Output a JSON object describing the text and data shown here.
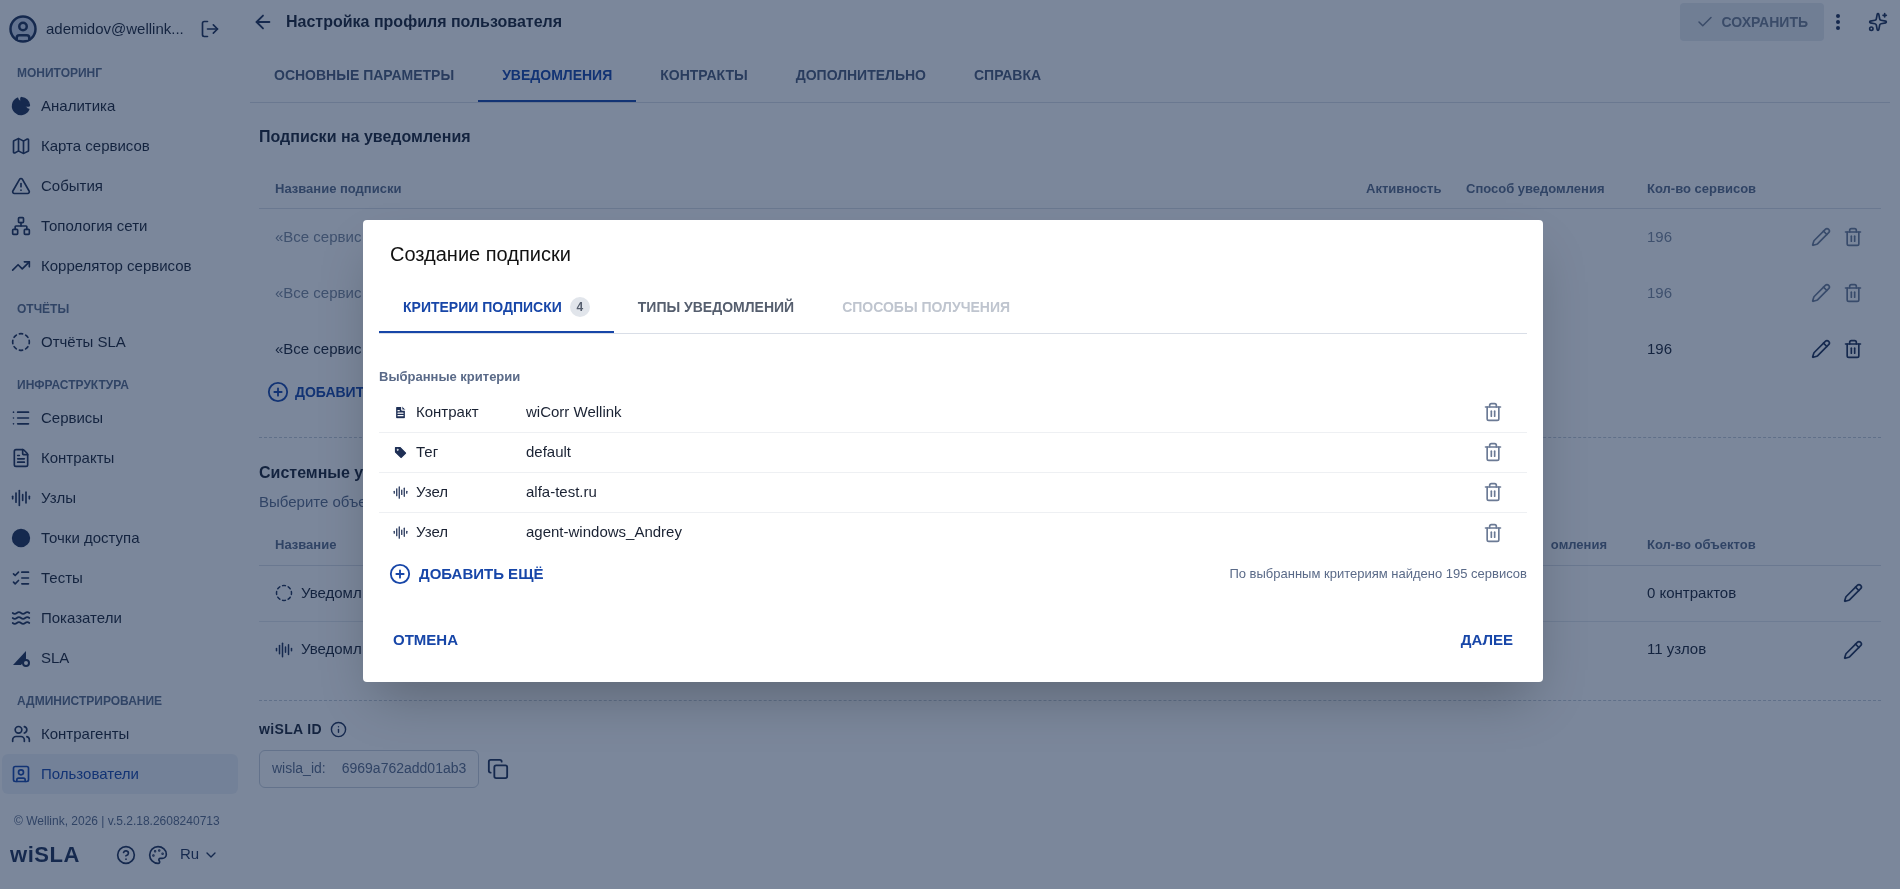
{
  "sidebar": {
    "user": "ademidov@wellink...",
    "sections": [
      {
        "title": "МОНИТОРИНГ",
        "items": [
          {
            "label": "Аналитика",
            "selected": false
          },
          {
            "label": "Карта сервисов",
            "selected": false
          },
          {
            "label": "События",
            "selected": false
          },
          {
            "label": "Топология сети",
            "selected": false
          },
          {
            "label": "Коррелятор сервисов",
            "selected": false
          }
        ]
      },
      {
        "title": "ОТЧЁТЫ",
        "items": [
          {
            "label": "Отчёты SLA",
            "selected": false
          }
        ]
      },
      {
        "title": "ИНФРАСТРУКТУРА",
        "items": [
          {
            "label": "Сервисы",
            "selected": false
          },
          {
            "label": "Контракты",
            "selected": false
          },
          {
            "label": "Узлы",
            "selected": false
          },
          {
            "label": "Точки доступа",
            "selected": false
          },
          {
            "label": "Тесты",
            "selected": false
          },
          {
            "label": "Показатели",
            "selected": false
          },
          {
            "label": "SLA",
            "selected": false
          }
        ]
      },
      {
        "title": "АДМИНИСТРИРОВАНИЕ",
        "items": [
          {
            "label": "Контрагенты",
            "selected": false
          },
          {
            "label": "Пользователи",
            "selected": true
          }
        ]
      }
    ],
    "footer": "© Wellink, 2026 | v.5.2.18.2608240713",
    "logo": "wiSLA",
    "language": "Ru"
  },
  "header": {
    "title": "Настройка профиля пользователя",
    "save": {
      "label": "СОХРАНИТЬ",
      "disabled": true
    }
  },
  "tabs": [
    {
      "label": "ОСНОВНЫЕ ПАРАМЕТРЫ",
      "selected": false
    },
    {
      "label": "УВЕДОМЛЕНИЯ",
      "selected": true
    },
    {
      "label": "КОНТРАКТЫ",
      "selected": false
    },
    {
      "label": "ДОПОЛНИТЕЛЬНО",
      "selected": false
    },
    {
      "label": "СПРАВКА",
      "selected": false
    }
  ],
  "subscriptions": {
    "title": "Подписки на уведомления",
    "columns": [
      "Название подписки",
      "Активность",
      "Способ уведомления",
      "Кол-во сервисов"
    ],
    "rows": [
      {
        "name": "«Все сервис",
        "count": "196",
        "active": false
      },
      {
        "name": "«Все сервис",
        "count": "196",
        "active": false
      },
      {
        "name": "«Все сервис",
        "count": "196",
        "active": true
      }
    ],
    "add": "ДОБАВИТ"
  },
  "system": {
    "title": "Системные у",
    "subtitle": "Выберите объе",
    "columns": [
      "Название",
      "омления",
      "Кол-во объектов"
    ],
    "rows": [
      {
        "name": "Уведомл",
        "count": "0 контрактов"
      },
      {
        "name": "Уведомл",
        "count": "11 узлов"
      }
    ]
  },
  "wisla_id": {
    "title": "wiSLA ID",
    "label": "wisla_id:",
    "value": "6969a762add01ab3"
  },
  "dialog": {
    "title": "Создание подписки",
    "tabs": [
      {
        "label": "КРИТЕРИИ ПОДПИСКИ",
        "badge": "4",
        "selected": true,
        "disabled": false
      },
      {
        "label": "ТИПЫ УВЕДОМЛЕНИЙ",
        "selected": false,
        "disabled": false
      },
      {
        "label": "СПОСОБЫ ПОЛУЧЕНИЯ",
        "selected": false,
        "disabled": true
      }
    ],
    "section": "Выбранные критерии",
    "criteria": [
      {
        "kind": "contract",
        "label": "Контракт",
        "value": "wiCorr Wellink"
      },
      {
        "kind": "tag",
        "label": "Тег",
        "value": "default"
      },
      {
        "kind": "node",
        "label": "Узел",
        "value": "alfa-test.ru"
      },
      {
        "kind": "node",
        "label": "Узел",
        "value": "agent-windows_Andrey"
      }
    ],
    "add": "ДОБАВИТЬ ЕЩЁ",
    "found": "По выбранным критериям найдено 195 сервисов",
    "cancel": "ОТМЕНА",
    "next": "ДАЛЕЕ"
  }
}
